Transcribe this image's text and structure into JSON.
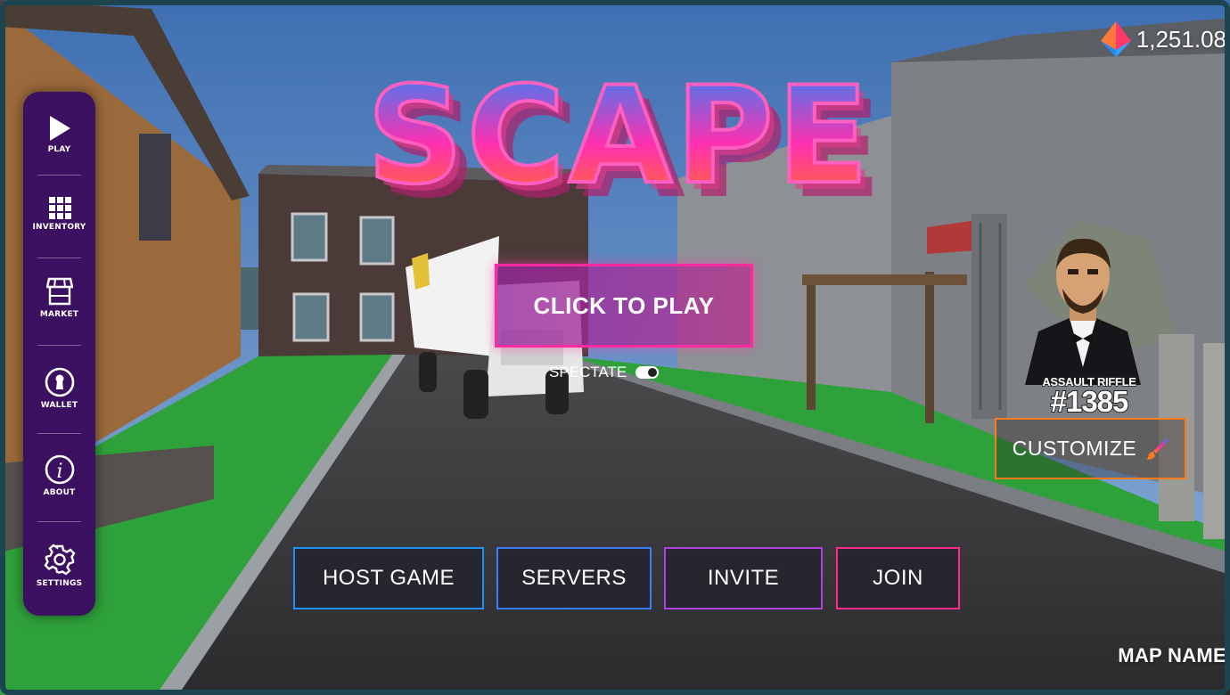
{
  "logo": {
    "text": "SCAPE"
  },
  "balance": {
    "amount": "1,251.08",
    "icon": "token-icon"
  },
  "sidebar": {
    "items": [
      {
        "label": "PLAY",
        "icon": "play-icon"
      },
      {
        "label": "INVENTORY",
        "icon": "grid-icon"
      },
      {
        "label": "MARKET",
        "icon": "store-icon"
      },
      {
        "label": "WALLET",
        "icon": "keyhole-icon"
      },
      {
        "label": "ABOUT",
        "icon": "info-icon"
      },
      {
        "label": "SETTINGS",
        "icon": "gear-icon"
      }
    ]
  },
  "main": {
    "play_label": "CLICK TO PLAY",
    "spectate_label": "SPECTATE",
    "spectate_on": false
  },
  "actions": {
    "host": "HOST GAME",
    "servers": "SERVERS",
    "invite": "INVITE",
    "join": "JOIN"
  },
  "character": {
    "weapon_name": "ASSAULT RIFFLE",
    "weapon_number": "#1385",
    "customize_label": "CUSTOMIZE"
  },
  "map": {
    "name": "MAP NAME"
  },
  "colors": {
    "sidebar_bg": "#3b1060",
    "play_border": "#ff2aa0",
    "host_border": "#1e90ff",
    "servers_border": "#3a7dff",
    "invite_border": "#b040e0",
    "join_border": "#ff2a8a",
    "customize_border": "#ff7a1a"
  }
}
